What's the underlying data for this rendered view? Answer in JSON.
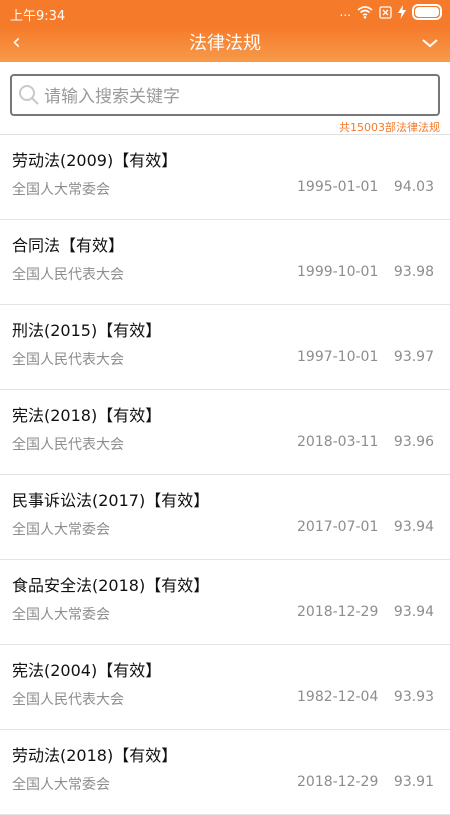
{
  "status_bar": {
    "time": "上午9:34",
    "dots": "...",
    "battery_level": 1.0
  },
  "app_bar": {
    "back_icon": "back-chevron-icon",
    "title": "法律法规",
    "menu_icon": "chevron-down-icon"
  },
  "search": {
    "placeholder": "请输入搜索关键字",
    "value": "",
    "count_text": "共15003部法律法规"
  },
  "laws": [
    {
      "title": "劳动法(2009)【有效】",
      "issuer": "全国人大常委会",
      "date": "1995-01-01",
      "score": "94.03"
    },
    {
      "title": "合同法【有效】",
      "issuer": "全国人民代表大会",
      "date": "1999-10-01",
      "score": "93.98"
    },
    {
      "title": "刑法(2015)【有效】",
      "issuer": "全国人民代表大会",
      "date": "1997-10-01",
      "score": "93.97"
    },
    {
      "title": "宪法(2018)【有效】",
      "issuer": "全国人民代表大会",
      "date": "2018-03-11",
      "score": "93.96"
    },
    {
      "title": "民事诉讼法(2017)【有效】",
      "issuer": "全国人大常委会",
      "date": "2017-07-01",
      "score": "93.94"
    },
    {
      "title": "食品安全法(2018)【有效】",
      "issuer": "全国人大常委会",
      "date": "2018-12-29",
      "score": "93.94"
    },
    {
      "title": "宪法(2004)【有效】",
      "issuer": "全国人民代表大会",
      "date": "1982-12-04",
      "score": "93.93"
    },
    {
      "title": "劳动法(2018)【有效】",
      "issuer": "全国人大常委会",
      "date": "2018-12-29",
      "score": "93.91"
    }
  ],
  "colors": {
    "accent": "#f57a2a",
    "meta_text": "#8d8d8d"
  }
}
